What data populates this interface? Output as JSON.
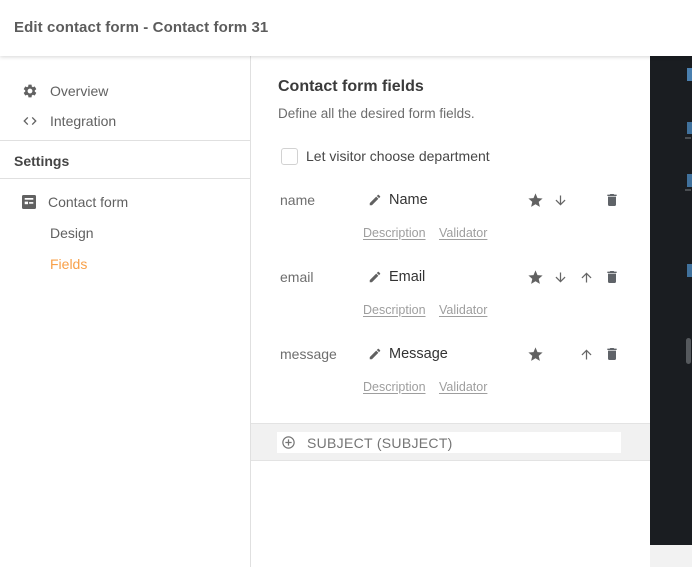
{
  "window": {
    "title": "Edit contact form - Contact form 31"
  },
  "sidebar": {
    "items": [
      {
        "label": "Overview"
      },
      {
        "label": "Integration"
      }
    ],
    "section": "Settings",
    "settings_items": [
      {
        "label": "Contact form"
      },
      {
        "label": "Design"
      },
      {
        "label": "Fields"
      }
    ]
  },
  "content": {
    "heading": "Contact form fields",
    "subheading": "Define all the desired form fields.",
    "checkbox": {
      "label": "Let visitor choose department",
      "checked": false
    },
    "fields": [
      {
        "key": "name",
        "label": "Name",
        "links": [
          "Description",
          "Validator"
        ]
      },
      {
        "key": "email",
        "label": "Email",
        "links": [
          "Description",
          "Validator"
        ]
      },
      {
        "key": "message",
        "label": "Message",
        "links": [
          "Description",
          "Validator"
        ]
      }
    ],
    "add_row": {
      "label": "SUBJECT (SUBJECT)"
    }
  },
  "colors": {
    "accent_orange": "#f8a048",
    "icon_gray": "#616161",
    "dark_panel": "#1a1d21"
  }
}
